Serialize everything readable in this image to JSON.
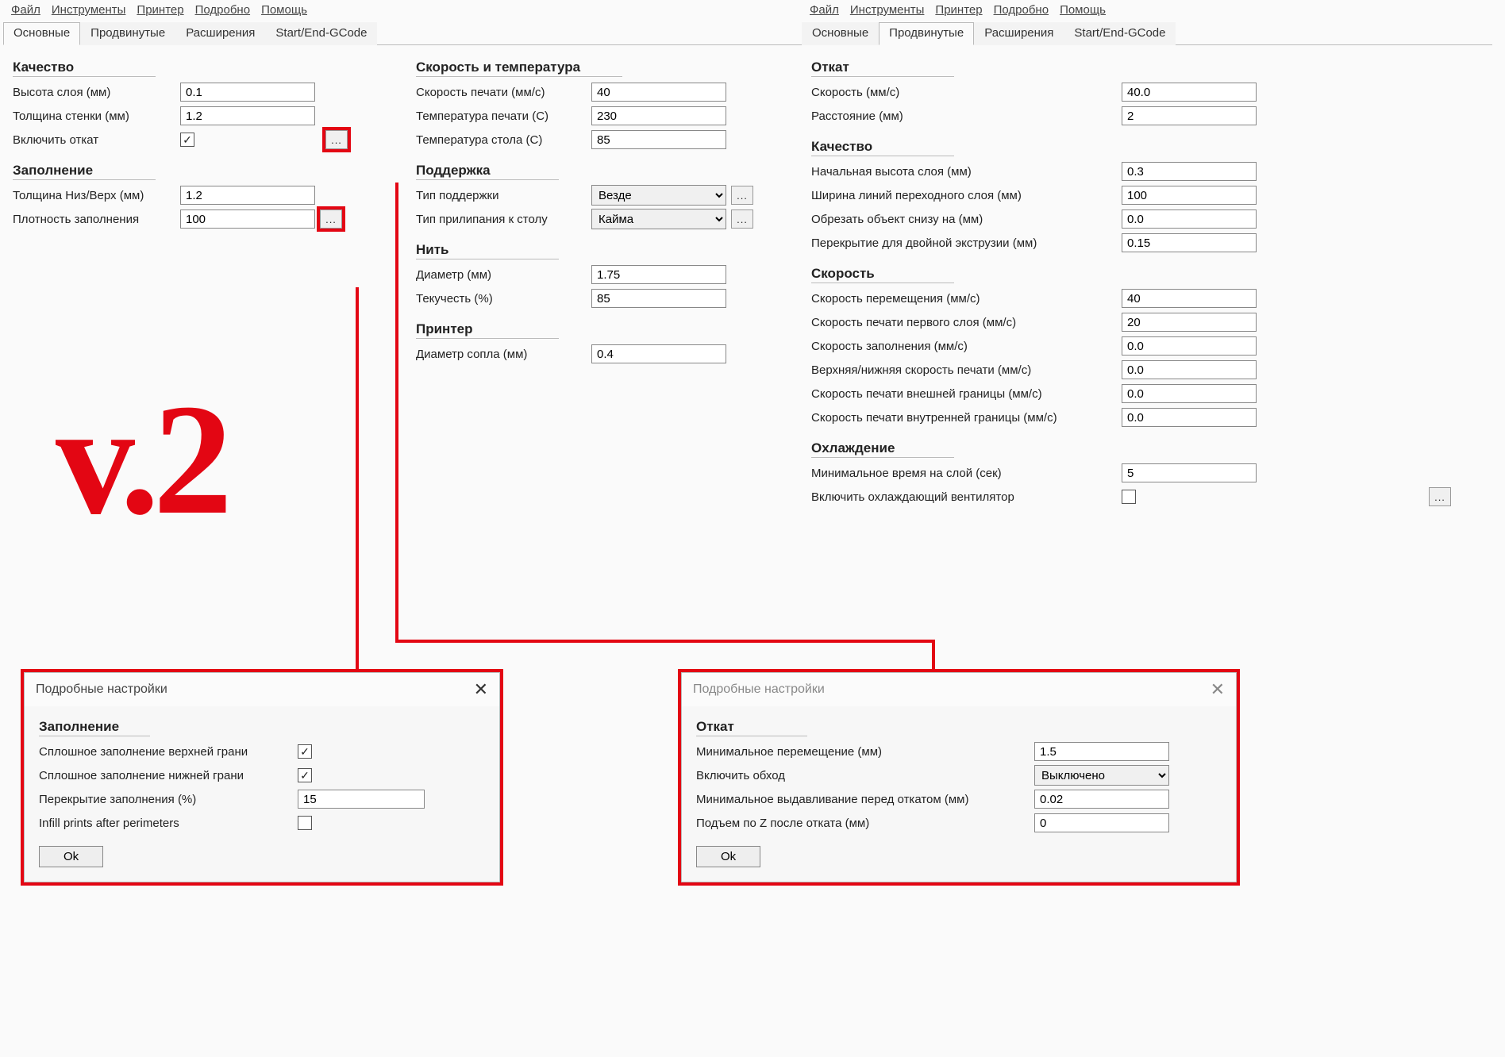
{
  "menu": {
    "file": "Файл",
    "tools": "Инструменты",
    "printer": "Принтер",
    "detail": "Подробно",
    "help": "Помощь"
  },
  "tabs": {
    "basic": "Основные",
    "advanced": "Продвинутые",
    "ext": "Расширения",
    "gcode": "Start/End-GCode"
  },
  "left": {
    "quality_h": "Качество",
    "layer_h_lbl": "Высота слоя (мм)",
    "layer_h_val": "0.1",
    "wall_lbl": "Толщина стенки (мм)",
    "wall_val": "1.2",
    "retract_lbl": "Включить откат",
    "fill_h": "Заполнение",
    "topbot_lbl": "Толщина Низ/Верх (мм)",
    "topbot_val": "1.2",
    "density_lbl": "Плотность заполнения",
    "density_val": "100",
    "speed_h": "Скорость и температура",
    "print_speed_lbl": "Скорость печати (мм/с)",
    "print_speed_val": "40",
    "print_temp_lbl": "Температура печати (С)",
    "print_temp_val": "230",
    "bed_temp_lbl": "Температура стола (С)",
    "bed_temp_val": "85",
    "support_h": "Поддержка",
    "support_type_lbl": "Тип поддержки",
    "support_type_val": "Везде",
    "adhesion_lbl": "Тип прилипания к столу",
    "adhesion_val": "Кайма",
    "filament_h": "Нить",
    "diameter_lbl": "Диаметр (мм)",
    "diameter_val": "1.75",
    "flow_lbl": "Текучесть (%)",
    "flow_val": "85",
    "printer_h": "Принтер",
    "nozzle_lbl": "Диаметр сопла (мм)",
    "nozzle_val": "0.4"
  },
  "right": {
    "retract_h": "Откат",
    "r_speed_lbl": "Скорость (мм/с)",
    "r_speed_val": "40.0",
    "r_dist_lbl": "Расстояние (мм)",
    "r_dist_val": "2",
    "quality_h": "Качество",
    "init_layer_lbl": "Начальная высота слоя (мм)",
    "init_layer_val": "0.3",
    "line_w_lbl": "Ширина линий переходного слоя (мм)",
    "line_w_val": "100",
    "cut_lbl": "Обрезать объект снизу на (мм)",
    "cut_val": "0.0",
    "overlap_lbl": "Перекрытие для двойной экструзии (мм)",
    "overlap_val": "0.15",
    "speed_h": "Скорость",
    "travel_lbl": "Скорость перемещения (мм/с)",
    "travel_val": "40",
    "first_layer_lbl": "Скорость печати первого слоя (мм/с)",
    "first_layer_val": "20",
    "infill_speed_lbl": "Скорость заполнения (мм/с)",
    "infill_speed_val": "0.0",
    "topbot_speed_lbl": "Верхняя/нижняя скорость печати (мм/с)",
    "topbot_speed_val": "0.0",
    "outer_lbl": "Скорость печати внешней границы (мм/с)",
    "outer_val": "0.0",
    "inner_lbl": "Скорость печати внутренней границы (мм/с)",
    "inner_val": "0.0",
    "cool_h": "Охлаждение",
    "min_time_lbl": "Минимальное время на слой (сек)",
    "min_time_val": "5",
    "fan_lbl": "Включить охлаждающий вентилятор"
  },
  "dlg_fill": {
    "title": "Подробные настройки",
    "section": "Заполнение",
    "solid_top": "Сплошное заполнение верхней грани",
    "solid_bot": "Сплошное заполнение нижней грани",
    "overlap_lbl": "Перекрытие заполнения (%)",
    "overlap_val": "15",
    "after_perim": "Infill prints after perimeters",
    "ok": "Ok"
  },
  "dlg_retract": {
    "title": "Подробные настройки",
    "section": "Откат",
    "min_travel_lbl": "Минимальное перемещение (мм)",
    "min_travel_val": "1.5",
    "comb_lbl": "Включить обход",
    "comb_val": "Выключено",
    "min_ext_lbl": "Минимальное выдавливание перед откатом (мм)",
    "min_ext_val": "0.02",
    "zhop_lbl": "Подъем по Z после отката (мм)",
    "zhop_val": "0",
    "ok": "Ok"
  },
  "overlay": {
    "v2": "v.2",
    "dots": "..."
  }
}
